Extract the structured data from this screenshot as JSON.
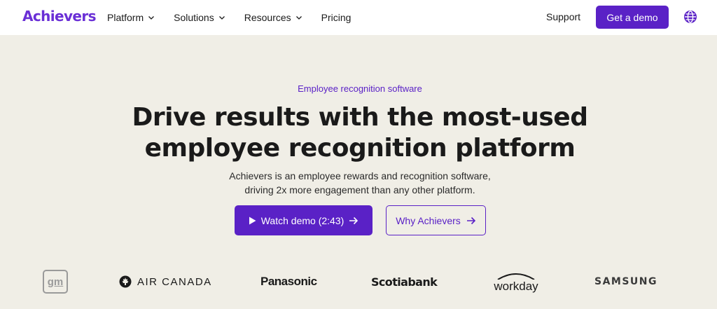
{
  "brand": {
    "name": "Achievers",
    "color": "#6a2fd6"
  },
  "nav": {
    "items": [
      {
        "label": "Platform",
        "has_dropdown": true
      },
      {
        "label": "Solutions",
        "has_dropdown": true
      },
      {
        "label": "Resources",
        "has_dropdown": true
      },
      {
        "label": "Pricing",
        "has_dropdown": false
      }
    ],
    "support_label": "Support",
    "cta_label": "Get a demo",
    "language_icon": "globe-icon"
  },
  "hero": {
    "eyebrow": "Employee recognition software",
    "headline_line1": "Drive results with the most-used",
    "headline_line2": "employee recognition platform",
    "subtext_line1": "Achievers is an employee rewards and recognition software,",
    "subtext_line2": "driving 2x more engagement than any other platform.",
    "primary_button": {
      "icon": "play-icon",
      "label": "Watch demo (2:43)",
      "trailing_icon": "arrow-right-icon"
    },
    "secondary_button": {
      "label": "Why Achievers",
      "trailing_icon": "arrow-right-icon"
    }
  },
  "customer_logos": [
    {
      "name": "gm",
      "text": "gm"
    },
    {
      "name": "air-canada",
      "text": "AIR CANADA"
    },
    {
      "name": "panasonic",
      "text": "Panasonic"
    },
    {
      "name": "scotiabank",
      "text": "Scotiabank"
    },
    {
      "name": "workday",
      "text": "workday"
    },
    {
      "name": "samsung",
      "text": "SAMSUNG"
    }
  ],
  "colors": {
    "accent": "#5a21c6",
    "background": "#f0eee6",
    "nav_background": "#ffffff"
  }
}
